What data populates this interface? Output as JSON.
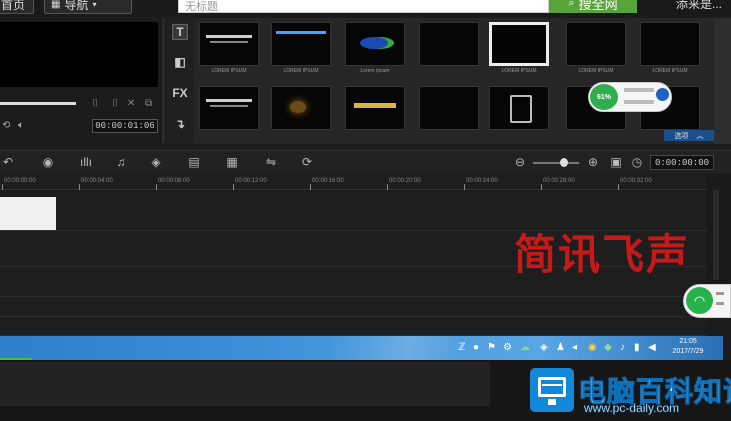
{
  "browser": {
    "home_tab": "首页",
    "nav_tab": "导航",
    "search_placeholder": "无标题",
    "search_button": "搜全网",
    "right_text": "添来是..."
  },
  "preview": {
    "timecode": "00:00:01:06"
  },
  "side_tabs": {
    "title": "T",
    "fx": "FX"
  },
  "library": {
    "items": [
      {
        "caption": "LOREM IPSUM"
      },
      {
        "caption": "LOREM IPSUM"
      },
      {
        "caption": "Lorem Ipsum"
      },
      {
        "caption": ""
      },
      {
        "caption": "LOREM IPSUM"
      },
      {
        "caption": "LOREM IPSUM"
      },
      {
        "caption": "LOREM IPSUM"
      },
      {
        "caption": ""
      },
      {
        "caption": ""
      },
      {
        "caption": ""
      },
      {
        "caption": ""
      },
      {
        "caption": ""
      },
      {
        "caption": ""
      },
      {
        "caption": ""
      }
    ],
    "footer_label": "选项"
  },
  "timeline": {
    "timecode": "0:00:00:00",
    "ruler": [
      "00:00:00:00",
      "00:00:04:00",
      "00:00:08:00",
      "00:00:12:00",
      "00:00:16:00",
      "00:00:20:00",
      "00:00:24:00",
      "00:00:28:00",
      "00:00:32:00"
    ]
  },
  "overlay": {
    "watermark": "简讯飞声"
  },
  "taskbar": {
    "time": "21:05",
    "date": "2017/7/29"
  },
  "net_widget": {
    "percent": "61%"
  },
  "site_logo": {
    "name": "电脑百科知识",
    "url": "www.pc-daily.com"
  },
  "colors": {
    "accent_green": "#5aa33c",
    "watermark_red": "#c41a1a",
    "taskbar_blue": "#3f92d8",
    "logo_blue": "#1488d8"
  }
}
